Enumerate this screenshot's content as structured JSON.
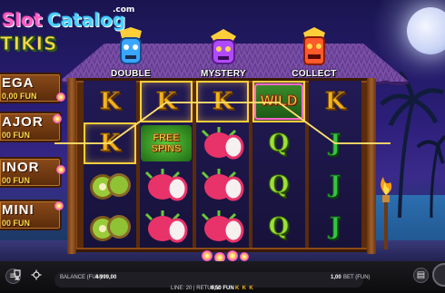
{
  "logo": {
    "slot": "Slot",
    "catalog": "Catalog",
    "com": ".com",
    "game_name": "TIKIS"
  },
  "features": [
    {
      "label": "DOUBLE",
      "icon": "blue-tiki-mask-icon"
    },
    {
      "label": "MYSTERY",
      "icon": "purple-tiki-mask-icon"
    },
    {
      "label": "COLLECT",
      "icon": "red-tiki-mask-icon"
    }
  ],
  "jackpots": [
    {
      "name": "EGA",
      "value": "0,00 FUN"
    },
    {
      "name": "AJOR",
      "value": "00 FUN"
    },
    {
      "name": "INOR",
      "value": "00 FUN"
    },
    {
      "name": "MINI",
      "value": "00 FUN"
    }
  ],
  "reels": [
    [
      "K",
      "K",
      "kiwi",
      "kiwi"
    ],
    [
      "K",
      "FREE SPINS",
      "dragonfruit",
      "dragonfruit"
    ],
    [
      "K",
      "dragonfruit",
      "dragonfruit",
      "dragonfruit"
    ],
    [
      "WILD",
      "Q",
      "Q",
      "Q"
    ],
    [
      "K",
      "J",
      "J",
      "J"
    ]
  ],
  "symbols": {
    "wild": "WILD",
    "free_spins_1": "FREE",
    "free_spins_2": "SPINS"
  },
  "bottom_bar": {
    "balance_label": "BALANCE (FUN)",
    "balance_value": "4 999,00",
    "line_label": "LINE: 20 | RETURN:",
    "line_value": "0,50 FUN",
    "bet_value": "1,00",
    "bet_label": "BET (FUN)"
  },
  "colors": {
    "gold": "#f2b21a",
    "payline": "#ffcf3a",
    "accent_pink": "#ff5ec3"
  }
}
